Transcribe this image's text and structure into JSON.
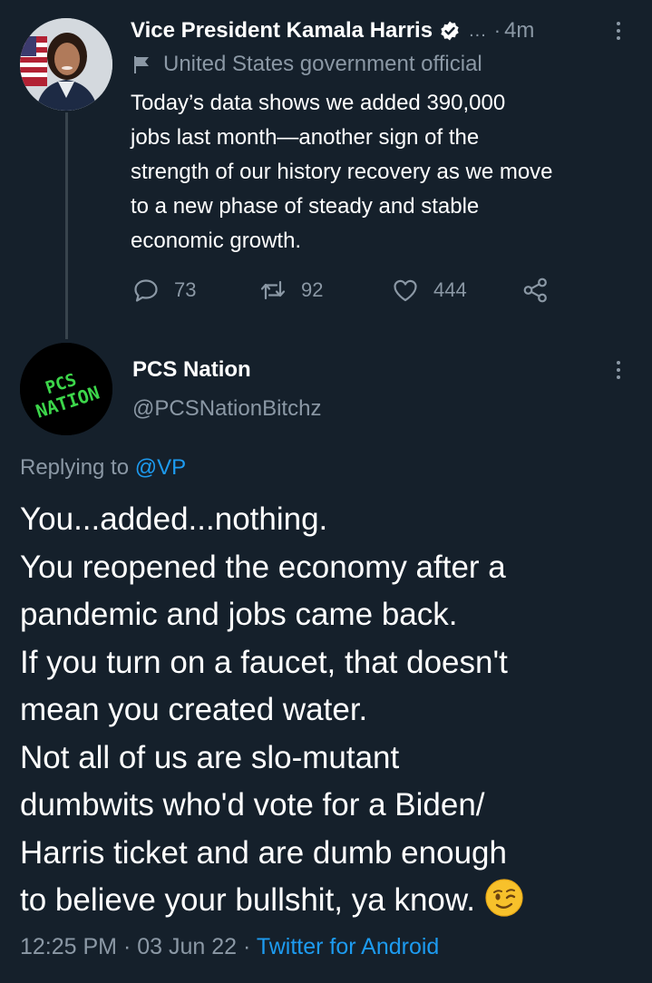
{
  "parent_tweet": {
    "author_name": "Vice President Kamala Harris",
    "ellipsis": "...",
    "separator": "·",
    "time": "4m",
    "label_icon": "flag-icon",
    "label": "United States government official",
    "body_lines": [
      "Today’s data shows we added 390,000",
      "jobs last month—another sign of the",
      "strength of our history recovery as we move",
      "to a new phase of steady and stable",
      "economic growth."
    ],
    "replies_count": "73",
    "retweets_count": "92",
    "likes_count": "444"
  },
  "reply_tweet": {
    "author_name": "PCS Nation",
    "handle": "@PCSNationBitchz",
    "avatar_text": "PCS NATION",
    "replying_prefix": "Replying to",
    "replying_to": "@VP",
    "body_lines": [
      "You...added...nothing.",
      "You reopened the economy after a",
      "pandemic and jobs came back.",
      "If you turn on a faucet, that doesn't",
      "mean you created water.",
      "Not all of us are slo-mutant",
      "dumbwits who'd vote for a Biden/",
      "Harris ticket and are dumb enough",
      "to believe your bullshit, ya know."
    ],
    "trailing_emoji": "winking-face",
    "time": "12:25 PM",
    "dot1": "·",
    "date": "03 Jun 22",
    "dot2": "·",
    "source": "Twitter for Android"
  },
  "colors": {
    "background": "#15202b",
    "text_primary": "#ffffff",
    "text_secondary": "#8b98a5",
    "accent": "#1d9bf0",
    "thread_line": "#38444d"
  }
}
